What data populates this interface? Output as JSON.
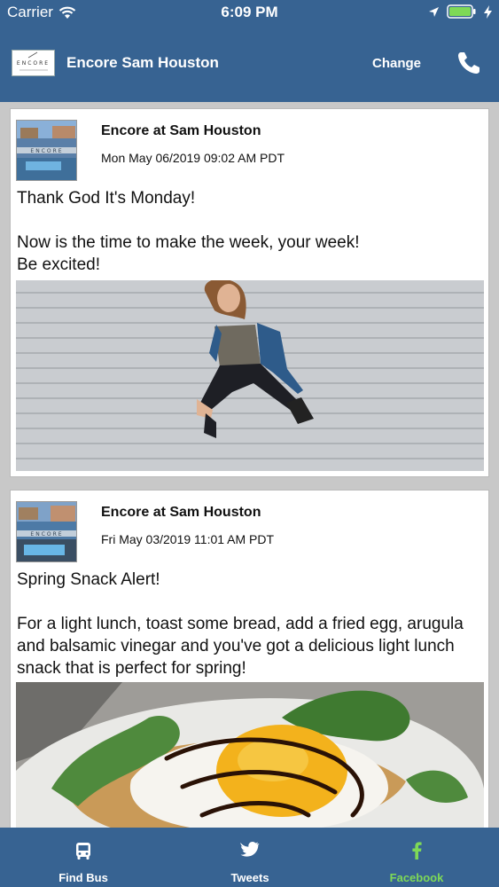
{
  "status": {
    "carrier": "Carrier",
    "time": "6:09 PM"
  },
  "header": {
    "title": "Encore Sam Houston",
    "change_label": "Change",
    "logo_text": "ENCORE"
  },
  "posts": [
    {
      "author": "Encore at Sam Houston",
      "date": "Mon May 06/2019 09:02 AM PDT",
      "text": "Thank God It's Monday!\n\nNow is the time to make the week, your week!\nBe excited!"
    },
    {
      "author": "Encore at Sam Houston",
      "date": "Fri May 03/2019 11:01 AM PDT",
      "text": "Spring Snack Alert!\n\nFor a light lunch, toast some bread, add a fried egg, arugula and balsamic vinegar and you've got a delicious light lunch snack that is perfect for spring!"
    }
  ],
  "tabs": [
    {
      "label": "Find Bus",
      "icon": "bus-icon"
    },
    {
      "label": "Tweets",
      "icon": "twitter-icon"
    },
    {
      "label": "Facebook",
      "icon": "facebook-icon"
    }
  ],
  "colors": {
    "header": "#376392",
    "active_tab": "#7ed957"
  }
}
